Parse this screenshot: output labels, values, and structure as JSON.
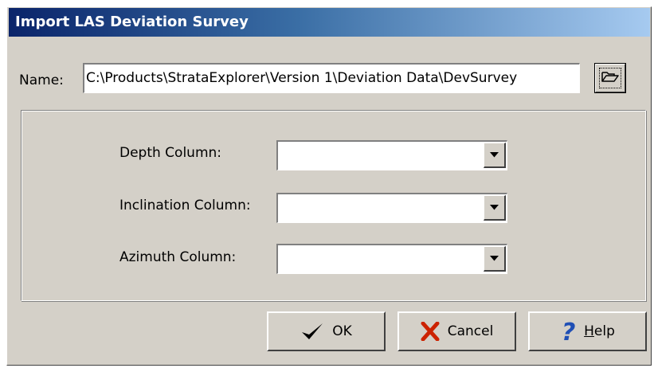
{
  "dialog": {
    "title": "Import LAS Deviation Survey"
  },
  "name_field": {
    "label": "Name:",
    "value": "C:\\Products\\StrataExplorer\\Version 1\\Deviation Data\\DevSurvey",
    "browse_icon": "folder-open-icon"
  },
  "columns": [
    {
      "label": "Depth Column:",
      "selected": ""
    },
    {
      "label": "Inclination Column:",
      "selected": ""
    },
    {
      "label": "Azimuth Column:",
      "selected": ""
    }
  ],
  "buttons": {
    "ok": {
      "label": "OK",
      "icon": "checkmark-icon"
    },
    "cancel": {
      "label": "Cancel",
      "icon": "x-icon"
    },
    "help": {
      "label": "Help",
      "mnemonic": "H",
      "rest": "elp",
      "icon": "question-icon"
    }
  },
  "colors": {
    "title_gradient_start": "#0a246a",
    "title_gradient_end": "#a6caf0",
    "face": "#d4d0c8",
    "cancel_x": "#cc2200",
    "help_q": "#1f4fb5"
  }
}
